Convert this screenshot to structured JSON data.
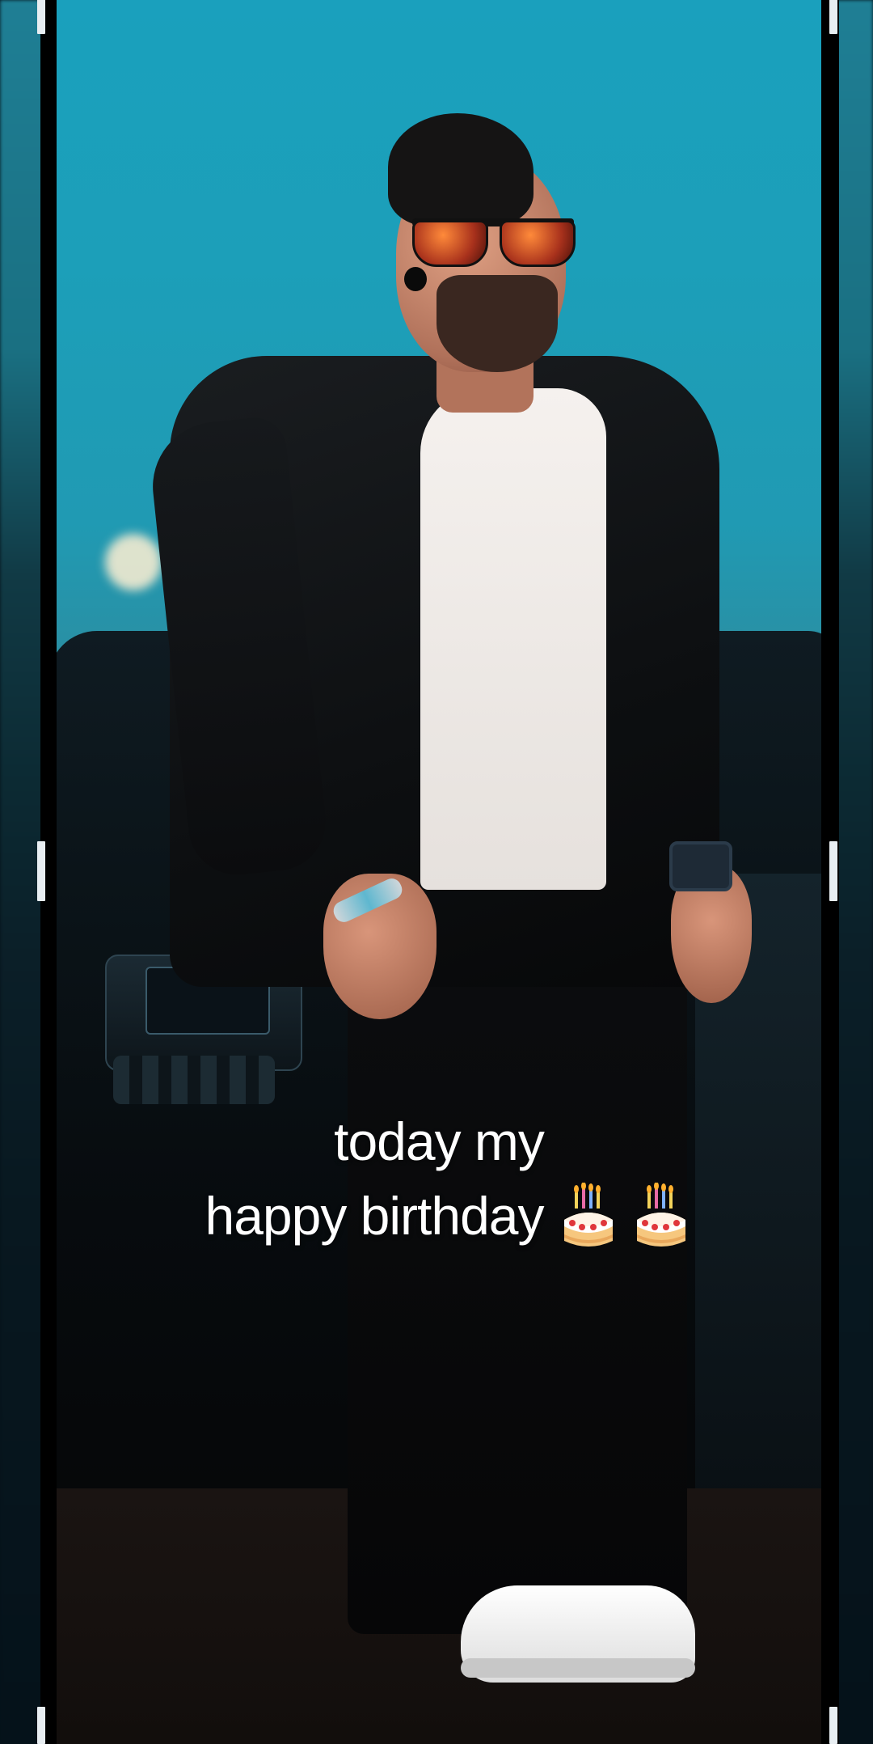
{
  "caption": {
    "line1": "today my",
    "line2": "happy birthday",
    "emojis": [
      "birthday-cake",
      "birthday-cake"
    ]
  },
  "colors": {
    "sky": "#1ca0bc",
    "caption_text": "#ffffff",
    "frame_marks": "#e8eef2"
  }
}
